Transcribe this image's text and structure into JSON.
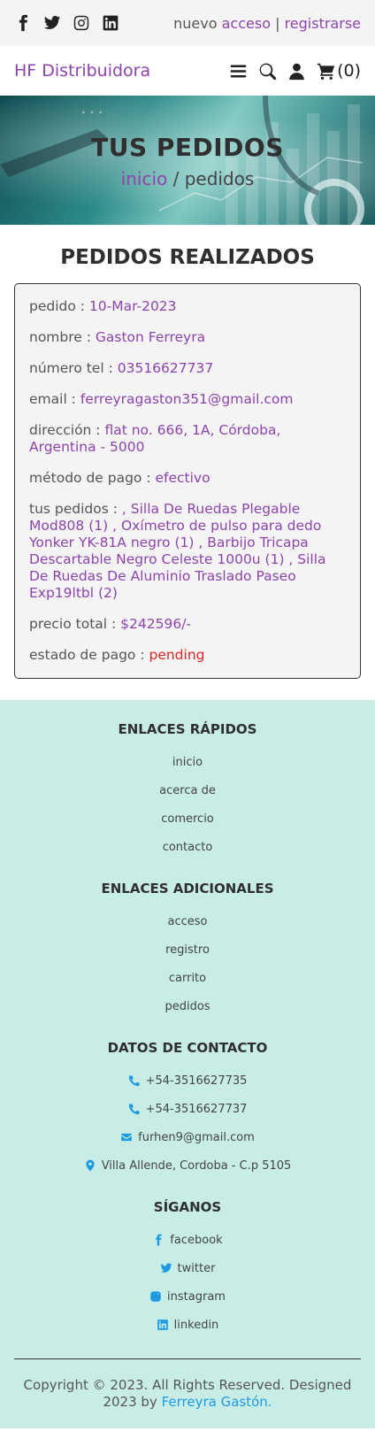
{
  "auth": {
    "prefix": "nuevo",
    "login": "acceso",
    "separator": "|",
    "register": "registrarse"
  },
  "brand": {
    "logo": "HF Distribuidora"
  },
  "cart": {
    "label": "(0)"
  },
  "hero": {
    "title": "TUS PEDIDOS",
    "crumb_home": "inicio",
    "crumb_sep": " / ",
    "crumb_current": "pedidos"
  },
  "orders": {
    "heading": "PEDIDOS REALIZADOS",
    "fields": [
      {
        "label": "pedido : ",
        "value": "10-Mar-2023"
      },
      {
        "label": "nombre : ",
        "value": "Gaston Ferreyra"
      },
      {
        "label": "número tel : ",
        "value": "03516627737"
      },
      {
        "label": "email : ",
        "value": "ferreyragaston351@gmail.com"
      },
      {
        "label": "dirección : ",
        "value": "flat no. 666, 1A, Córdoba, Argentina - 5000"
      },
      {
        "label": "método de pago : ",
        "value": "efectivo"
      },
      {
        "label": "tus pedidos : ",
        "value": ", Silla De Ruedas Plegable Mod808 (1) , Oxímetro de pulso para dedo Yonker YK-81A negro (1) , Barbijo Tricapa Descartable Negro Celeste 1000u (1) , Silla De Ruedas De Aluminio Traslado Paseo Exp19ltbl (2)"
      },
      {
        "label": "precio total : ",
        "value": "$242596/-"
      },
      {
        "label": "estado de pago : ",
        "value": "pending"
      }
    ]
  },
  "footer": {
    "quick": {
      "title": "ENLACES RÁPIDOS",
      "links": [
        "inicio",
        "acerca de",
        "comercio",
        "contacto"
      ]
    },
    "extra": {
      "title": "ENLACES ADICIONALES",
      "links": [
        "acceso",
        "registro",
        "carrito",
        "pedidos"
      ]
    },
    "contact": {
      "title": "DATOS DE CONTACTO",
      "items": [
        "+54-3516627735",
        "+54-3516627737",
        "furhen9@gmail.com",
        "Villa Allende, Cordoba - C.p 5105"
      ]
    },
    "follow": {
      "title": "SÍGANOS",
      "items": [
        "facebook",
        "twitter",
        "instagram",
        "linkedin"
      ]
    },
    "copyright": "Copyright © 2023. All Rights Reserved. Designed 2023 by ",
    "author": "Ferreyra Gastón."
  },
  "colors": {
    "accent": "#8e44ad",
    "footer_bg": "#c7ede6",
    "link_blue": "#1e9ae0",
    "pending": "#e32525"
  },
  "icons": [
    "facebook-icon",
    "twitter-icon",
    "instagram-icon",
    "linkedin-icon",
    "menu-icon",
    "search-icon",
    "user-icon",
    "cart-icon",
    "phone-icon",
    "envelope-icon",
    "map-marker-icon"
  ]
}
